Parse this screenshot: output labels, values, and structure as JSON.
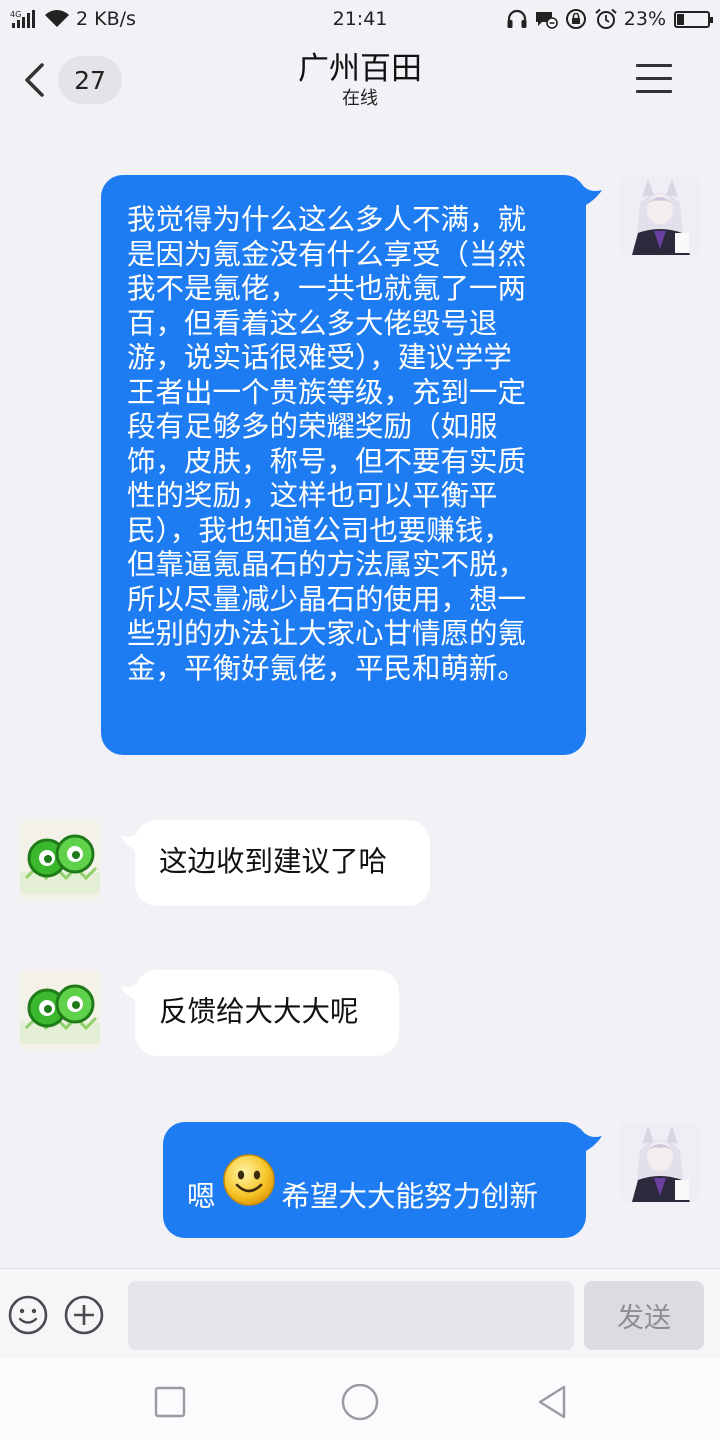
{
  "status_bar": {
    "network_type": "4G",
    "speed": "2 KB/s",
    "time": "21:41",
    "battery_percent": "23%",
    "battery_level": 0.23,
    "icons": [
      "signal-icon",
      "wifi-icon",
      "headphones-icon",
      "dnd-message-icon",
      "rotation-lock-icon",
      "alarm-icon",
      "battery-icon"
    ]
  },
  "header": {
    "unread_count": "27",
    "title": "广州百田",
    "subtitle": "在线"
  },
  "messages": [
    {
      "direction": "outgoing",
      "text": "我觉得为什么这么多人不满，就是因为氪金没有什么享受（当然我不是氪佬，一共也就氪了一两百，但看着这么多大佬毁号退游，说实话很难受），建议学学王者出一个贵族等级，充到一定段有足够多的荣耀奖励（如服饰，皮肤，称号，但不要有实质性的奖励，这样也可以平衡平民），我也知道公司也要赚钱，但靠逼氪晶石的方法属实不脱，所以尽量减少晶石的使用，想一些别的办法让大家心甘情愿的氪金，平衡好氪佬，平民和萌新。",
      "lines": [
        "我觉得为什么这么多人不满，就",
        "是因为氪金没有什么享受（当然",
        "我不是氪佬，一共也就氪了一两",
        "百，但看着这么多大佬毁号退",
        "游，说实话很难受），建议学学",
        "王者出一个贵族等级，充到一定",
        "段有足够多的荣耀奖励（如服",
        "饰，皮肤，称号，但不要有实质",
        "性的奖励，这样也可以平衡平",
        "民），我也知道公司也要赚钱，",
        "但靠逼氪晶石的方法属实不脱，",
        "所以尽量减少晶石的使用，想一",
        "些别的办法让大家心甘情愿的氪",
        "金，平衡好氪佬，平民和萌新。"
      ]
    },
    {
      "direction": "incoming",
      "text": "这边收到建议了哈"
    },
    {
      "direction": "incoming",
      "text": "反馈给大大大呢"
    },
    {
      "direction": "outgoing",
      "text_before": "嗯",
      "emoji": "smile-emoji",
      "text_after": "希望大大能努力创新"
    }
  ],
  "input": {
    "value": "",
    "send_label": "发送"
  },
  "colors": {
    "outgoing_bubble": "#1e7cf2",
    "incoming_bubble": "#ffffff",
    "background": "#f1f1f6",
    "logo_green": "#3bb82e"
  }
}
